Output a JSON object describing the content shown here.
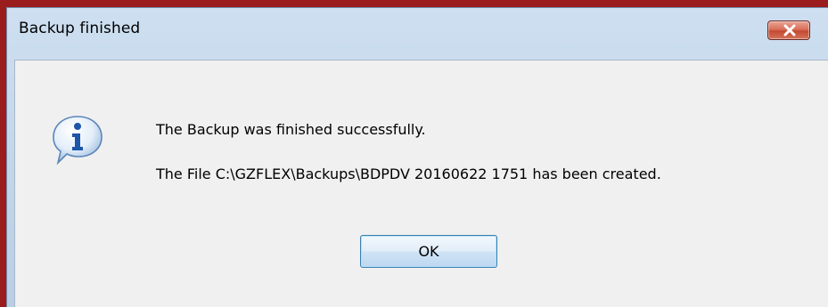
{
  "window": {
    "title": "Backup finished",
    "close_icon": "close-icon"
  },
  "message": {
    "icon": "info-icon",
    "line1": "The Backup was finished successfully.",
    "line2": "The File C:\\GZFLEX\\Backups\\BDPDV 20160622 1751 has been created."
  },
  "buttons": {
    "ok_label": "OK"
  },
  "colors": {
    "accent_frame": "#9b1c1c",
    "titlebar": "#c4d8ec",
    "client_bg": "#f0f0f0",
    "close_button": "#c44a32",
    "ok_border": "#3c7fb1"
  }
}
